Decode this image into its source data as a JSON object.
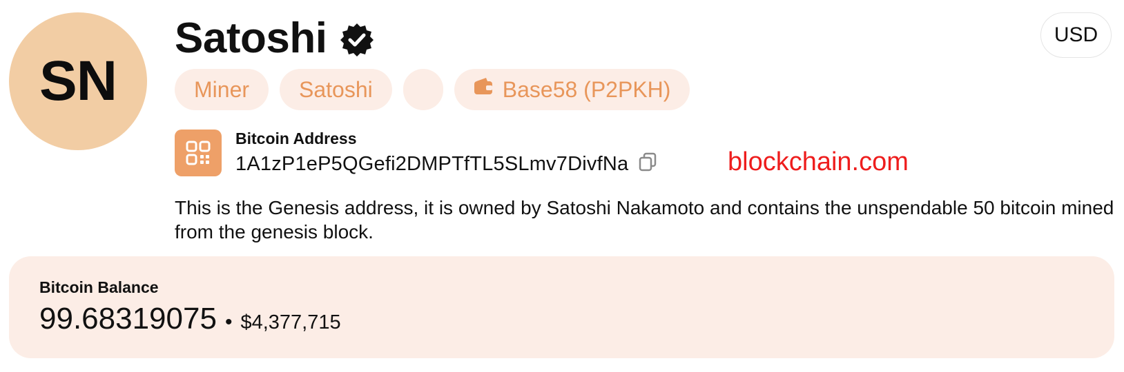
{
  "profile": {
    "initials": "SN",
    "name": "Satoshi",
    "verified_icon": "verified-badge-icon",
    "avatar_color": "#f2cda4"
  },
  "currency": {
    "label": "USD"
  },
  "tags": [
    {
      "label": "Miner"
    },
    {
      "label": "Satoshi"
    },
    {
      "label": ""
    },
    {
      "label": "Base58 (P2PKH)",
      "icon": "wallet-icon"
    }
  ],
  "address": {
    "label": "Bitcoin Address",
    "value": "1A1zP1eP5QGefi2DMPTfTL5SLmv7DivfNa",
    "qr_icon": "qr-code-icon",
    "copy_icon": "copy-icon"
  },
  "watermark": {
    "text": "blockchain.com",
    "color": "#ee1d1d"
  },
  "description": "This is the Genesis address, it is owned by Satoshi Nakamoto and contains the unspendable 50 bitcoin mined from the genesis block.",
  "balance": {
    "label": "Bitcoin Balance",
    "btc": "99.68319075",
    "separator": "•",
    "usd": "$4,377,715"
  },
  "colors": {
    "accent": "#eea068",
    "tag_bg": "#fcede6",
    "tag_text": "#e8965a"
  }
}
